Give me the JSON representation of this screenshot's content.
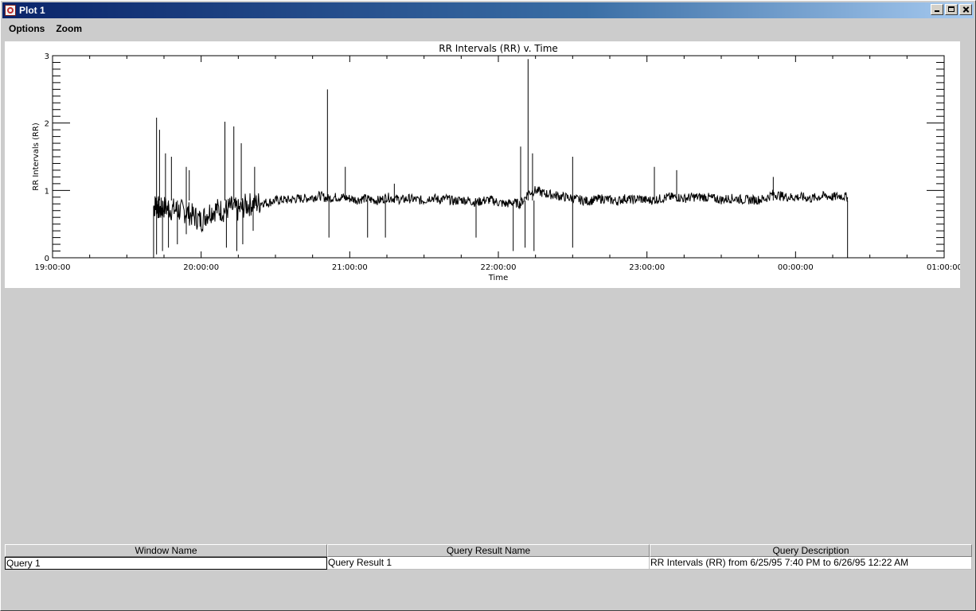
{
  "window": {
    "title": "Plot 1"
  },
  "menu": {
    "items": [
      "Options",
      "Zoom"
    ]
  },
  "chart_data": {
    "type": "line",
    "title": "RR Intervals (RR) v. Time",
    "xlabel": "Time",
    "ylabel": "RR Intervals (RR)",
    "x_ticks": [
      "19:00:00",
      "20:00:00",
      "21:00:00",
      "22:00:00",
      "23:00:00",
      "00:00:00",
      "01:00:00"
    ],
    "y_ticks": [
      0,
      1,
      2,
      3
    ],
    "ylim": [
      0,
      3
    ],
    "xlim_hours": [
      19,
      25
    ],
    "grid": false,
    "series": [
      {
        "x_hours": [
          19.68,
          19.7,
          19.72,
          19.75,
          19.8,
          19.85,
          19.9,
          19.95,
          20.0,
          20.05,
          20.1,
          20.15,
          20.2,
          20.25,
          20.3,
          20.35,
          20.4,
          20.45,
          20.5,
          20.55,
          20.6,
          20.65,
          20.7,
          20.75,
          20.8,
          20.85,
          20.9,
          20.95,
          21.0,
          21.05,
          21.1,
          21.15,
          21.2,
          21.25,
          21.3,
          21.35,
          21.4,
          21.45,
          21.5,
          21.55,
          21.6,
          21.65,
          21.7,
          21.75,
          21.8,
          21.85,
          21.9,
          21.95,
          22.0,
          22.05,
          22.1,
          22.15,
          22.2,
          22.25,
          22.3,
          22.35,
          22.4,
          22.45,
          22.5,
          22.55,
          22.6,
          22.65,
          22.7,
          22.75,
          22.8,
          22.85,
          22.9,
          22.95,
          23.0,
          23.05,
          23.1,
          23.15,
          23.2,
          23.25,
          23.3,
          23.35,
          23.4,
          23.45,
          23.5,
          23.55,
          23.6,
          23.65,
          23.7,
          23.75,
          23.8,
          23.85,
          23.9,
          23.95,
          24.0,
          24.05,
          24.1,
          24.15,
          24.2,
          24.25,
          24.3,
          24.35
        ],
        "values": [
          0.75,
          0.8,
          0.7,
          0.75,
          0.72,
          0.7,
          0.68,
          0.62,
          0.55,
          0.68,
          0.72,
          0.7,
          0.75,
          0.7,
          0.78,
          0.8,
          0.82,
          0.82,
          0.85,
          0.86,
          0.86,
          0.88,
          0.88,
          0.9,
          0.92,
          0.88,
          0.9,
          0.9,
          0.88,
          0.86,
          0.88,
          0.86,
          0.85,
          0.9,
          0.88,
          0.86,
          0.88,
          0.86,
          0.85,
          0.9,
          0.86,
          0.88,
          0.84,
          0.86,
          0.85,
          0.82,
          0.85,
          0.86,
          0.82,
          0.8,
          0.82,
          0.8,
          0.96,
          1.0,
          0.96,
          0.94,
          0.92,
          0.9,
          0.88,
          0.86,
          0.84,
          0.86,
          0.88,
          0.86,
          0.84,
          0.88,
          0.86,
          0.88,
          0.85,
          0.86,
          0.88,
          0.9,
          0.9,
          0.88,
          0.9,
          0.9,
          0.9,
          0.88,
          0.86,
          0.88,
          0.88,
          0.86,
          0.86,
          0.86,
          0.88,
          0.95,
          0.92,
          0.9,
          0.9,
          0.9,
          0.88,
          0.9,
          0.92,
          0.9,
          0.92,
          0.9
        ]
      }
    ],
    "spikes": [
      {
        "x": 19.7,
        "y": 2.08
      },
      {
        "x": 19.72,
        "y": 1.9
      },
      {
        "x": 19.76,
        "y": 1.55
      },
      {
        "x": 19.8,
        "y": 1.5
      },
      {
        "x": 19.9,
        "y": 1.35
      },
      {
        "x": 19.92,
        "y": 1.3
      },
      {
        "x": 20.16,
        "y": 2.02
      },
      {
        "x": 20.22,
        "y": 1.95
      },
      {
        "x": 20.27,
        "y": 1.7
      },
      {
        "x": 20.36,
        "y": 1.35
      },
      {
        "x": 20.85,
        "y": 2.5
      },
      {
        "x": 20.97,
        "y": 1.35
      },
      {
        "x": 21.3,
        "y": 1.1
      },
      {
        "x": 22.15,
        "y": 1.65
      },
      {
        "x": 22.2,
        "y": 2.95
      },
      {
        "x": 22.23,
        "y": 1.55
      },
      {
        "x": 22.5,
        "y": 1.5
      },
      {
        "x": 23.05,
        "y": 1.35
      },
      {
        "x": 23.2,
        "y": 1.3
      },
      {
        "x": 23.85,
        "y": 1.2
      }
    ],
    "dips": [
      {
        "x": 19.7,
        "y": 0.05
      },
      {
        "x": 19.74,
        "y": 0.1
      },
      {
        "x": 19.78,
        "y": 0.15
      },
      {
        "x": 19.84,
        "y": 0.2
      },
      {
        "x": 19.9,
        "y": 0.35
      },
      {
        "x": 20.17,
        "y": 0.15
      },
      {
        "x": 20.24,
        "y": 0.1
      },
      {
        "x": 20.28,
        "y": 0.2
      },
      {
        "x": 20.35,
        "y": 0.4
      },
      {
        "x": 20.86,
        "y": 0.3
      },
      {
        "x": 21.12,
        "y": 0.3
      },
      {
        "x": 21.24,
        "y": 0.3
      },
      {
        "x": 21.85,
        "y": 0.3
      },
      {
        "x": 22.1,
        "y": 0.1
      },
      {
        "x": 22.18,
        "y": 0.15
      },
      {
        "x": 22.24,
        "y": 0.1
      },
      {
        "x": 22.5,
        "y": 0.15
      },
      {
        "x": 24.35,
        "y": 0.0
      }
    ]
  },
  "table": {
    "headers": [
      "Window Name",
      "Query Result Name",
      "Query Description"
    ],
    "rows": [
      [
        "Query 1",
        "Query Result 1",
        "RR Intervals (RR) from 6/25/95 7:40 PM to 6/26/95 12:22 AM"
      ]
    ]
  }
}
